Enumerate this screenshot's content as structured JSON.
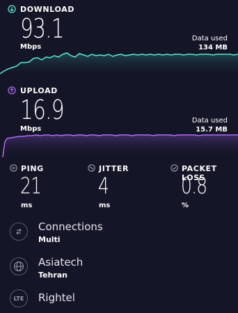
{
  "download": {
    "label": "DOWNLOAD",
    "value": "93.1",
    "unit": "Mbps",
    "data_used_label": "Data used",
    "data_used_value": "134 MB",
    "color": "#5de8d4"
  },
  "upload": {
    "label": "UPLOAD",
    "value": "16.9",
    "unit": "Mbps",
    "data_used_label": "Data used",
    "data_used_value": "15.7 MB",
    "color": "#b26cf0"
  },
  "metrics": {
    "ping": {
      "label": "PING",
      "value": "21",
      "unit": "ms"
    },
    "jitter": {
      "label": "JITTER",
      "value": "4",
      "unit": "ms"
    },
    "packet_loss": {
      "label": "PACKET LOSS",
      "value": "0.8",
      "unit": "%"
    }
  },
  "connections": {
    "title": "Connections",
    "value": "Multi"
  },
  "server": {
    "title": "Asiatech",
    "location": "Tehran"
  },
  "provider": {
    "badge": "LTE",
    "name": "Rightel"
  }
}
